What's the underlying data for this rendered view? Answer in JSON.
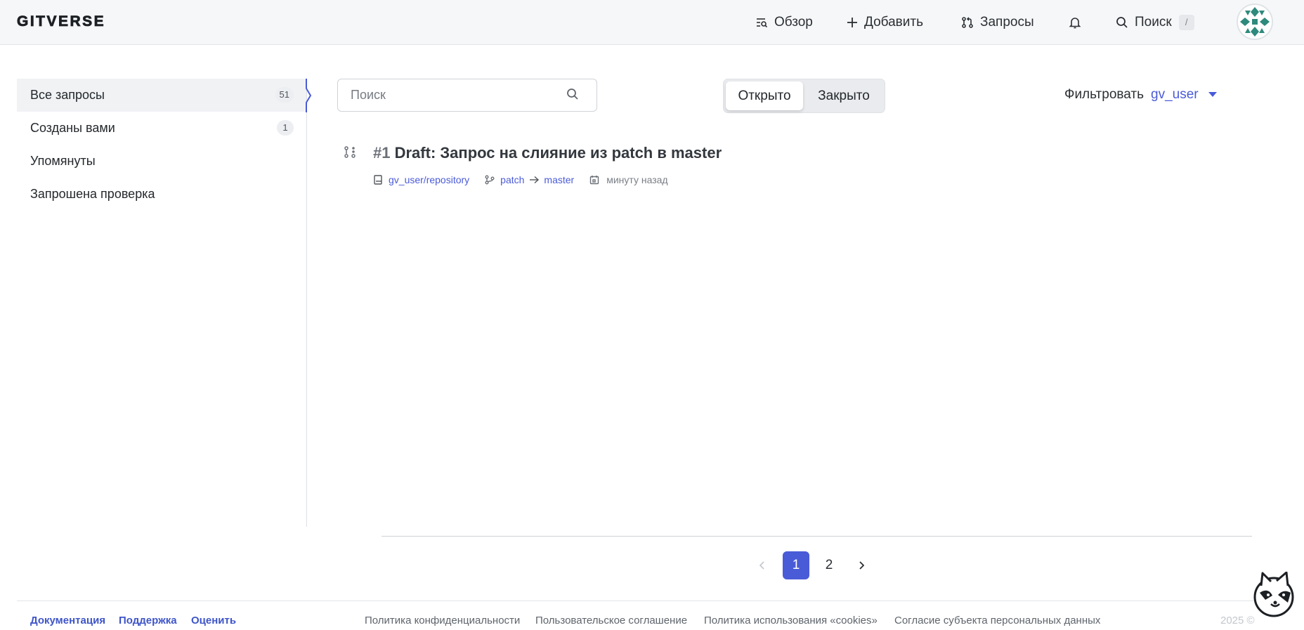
{
  "header": {
    "logo": "GITVERSE",
    "nav": {
      "overview": "Обзор",
      "add": "Добавить",
      "requests": "Запросы",
      "search": "Поиск",
      "search_shortcut": "/"
    }
  },
  "sidebar": {
    "items": [
      {
        "label": "Все запросы",
        "count": "51",
        "active": true
      },
      {
        "label": "Созданы вами",
        "count": "1"
      },
      {
        "label": "Упомянуты"
      },
      {
        "label": "Запрошена проверка"
      }
    ]
  },
  "toolbar": {
    "search_placeholder": "Поиск",
    "state_tabs": [
      "Открыто",
      "Закрыто"
    ],
    "filter_label": "Фильтровать",
    "filter_value": "gv_user"
  },
  "pull_requests": [
    {
      "number": "#1",
      "title": "Draft: Запрос на слияние из patch в master",
      "repository": "gv_user/repository",
      "source_branch": "patch",
      "target_branch": "master",
      "time": "минуту назад"
    }
  ],
  "pagination": {
    "pages": [
      "1",
      "2"
    ],
    "current": "1"
  },
  "footer": {
    "links_left": [
      "Документация",
      "Поддержка",
      "Оценить"
    ],
    "links_center": [
      "Политика конфиденциальности",
      "Пользовательское соглашение",
      "Политика использования «cookies»",
      "Согласие субъекта персональных данных"
    ],
    "copyright": "2025 ©"
  },
  "colors": {
    "accent": "#4a5bd8",
    "link": "#3e55c9"
  }
}
